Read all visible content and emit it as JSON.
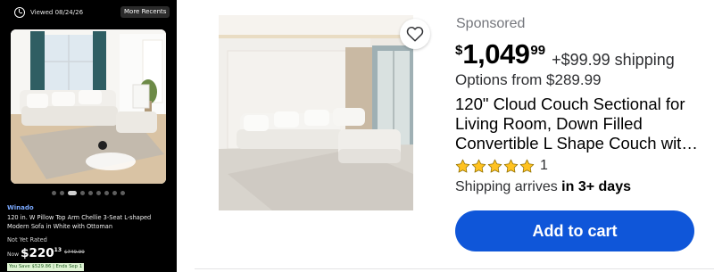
{
  "recently_viewed": {
    "viewed_label": "Viewed 08/24/26",
    "more_recents_label": "More Recents",
    "image_icon": "sofa-photo",
    "carousel_dots": 9,
    "carousel_active_index": 2,
    "brand": "Winado",
    "title": "120 in. W Pillow Top Arm Chellie 3-Seat L-shaped Modern Sofa in White with Ottoman",
    "rating_text": "Not Yet Rated",
    "price_prefix": "Now",
    "price": "$220",
    "price_cents": "13",
    "was_price": "$749.99",
    "savings": "You Save $529.86 | Ends Sep 1"
  },
  "product": {
    "image_icon": "sectional-sofa-photo",
    "favorite_icon": "heart-icon",
    "sponsored_label": "Sponsored",
    "price_currency": "$",
    "price_dollars": "1,049",
    "price_cents": "99",
    "shipping_fee": "+$99.99 shipping",
    "options_text": "Options from $289.99",
    "title": "120\" Cloud Couch Sectional for Living Room, Down Filled Convertible L Shape Couch wit…",
    "rating": 5,
    "rating_max": 5,
    "review_count": "1",
    "shipping_prefix": "Shipping arrives ",
    "shipping_emphasis": "in 3+ days",
    "add_to_cart_label": "Add to cart"
  },
  "colors": {
    "brand_blue": "#0f56d9",
    "star_gold": "#ffc220",
    "text_dark": "#2e2f32",
    "muted": "#74767c"
  }
}
